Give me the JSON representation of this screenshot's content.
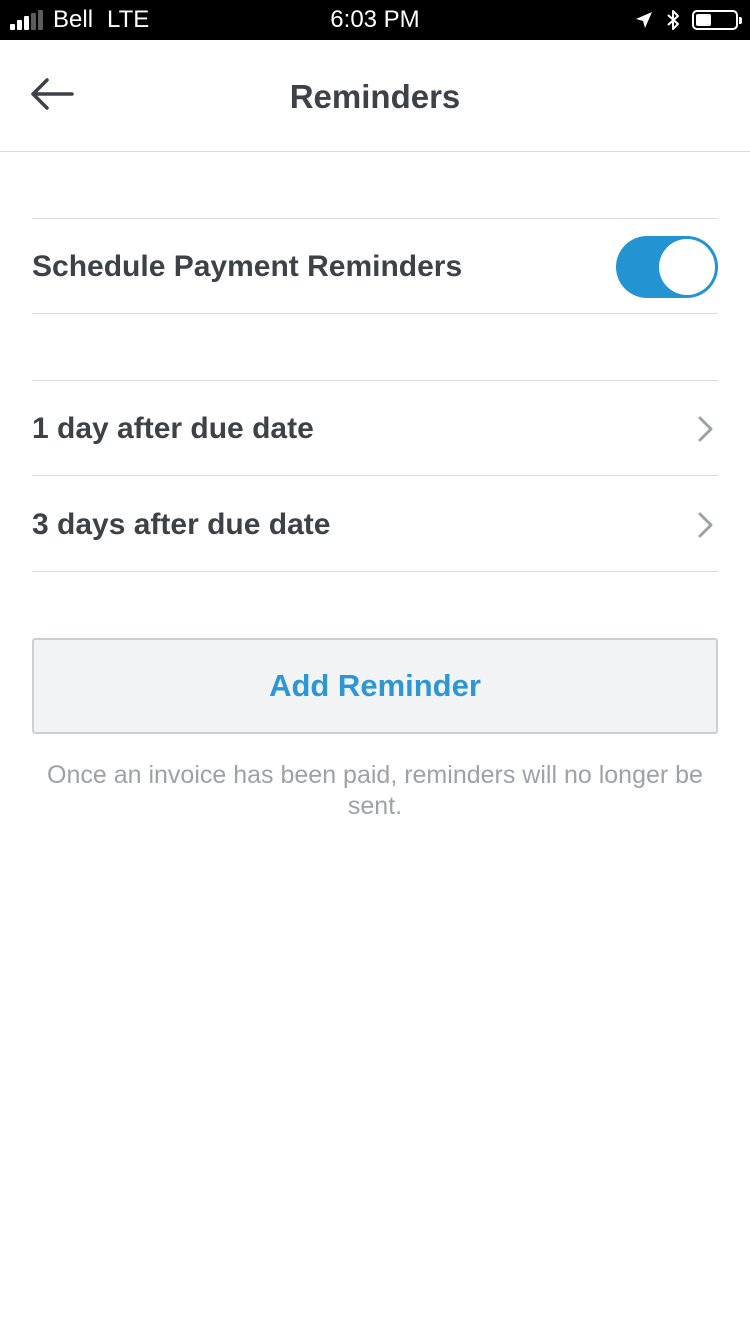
{
  "status_bar": {
    "carrier": "Bell",
    "network": "LTE",
    "time": "6:03 PM",
    "signal_bars_filled": 3,
    "signal_bars_total": 5,
    "battery_level_percent": 40,
    "icons": [
      "location-arrow-icon",
      "bluetooth-icon",
      "battery-icon"
    ]
  },
  "header": {
    "title": "Reminders",
    "back_icon": "back-arrow-icon"
  },
  "schedule": {
    "label": "Schedule Payment Reminders",
    "enabled": true,
    "toggle_color": "#2393d2"
  },
  "reminders": [
    {
      "label": "1 day after due date"
    },
    {
      "label": "3 days after due date"
    }
  ],
  "add_button": {
    "label": "Add Reminder",
    "color": "#2c97d3"
  },
  "help_text": "Once an invoice has been paid, reminders will no longer be sent."
}
